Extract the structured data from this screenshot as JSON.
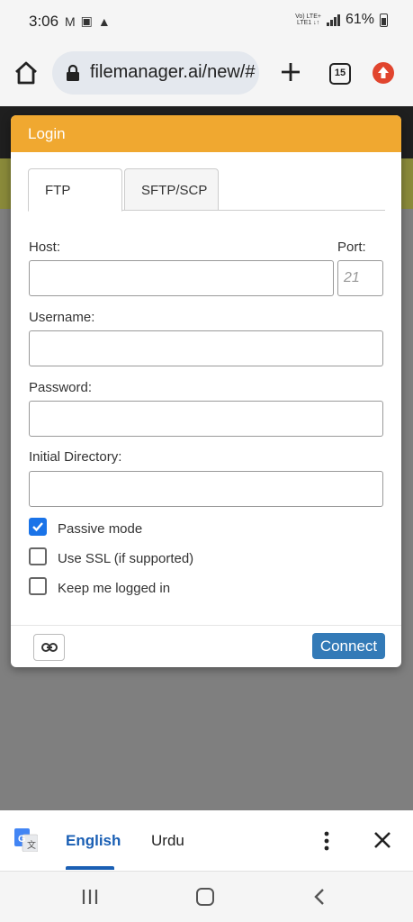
{
  "status_bar": {
    "time": "3:06",
    "network_top": "Vo) LTE+",
    "network_bottom": "LTE1 ↓↑",
    "battery": "61%"
  },
  "browser": {
    "url": "filemanager.ai/new/#",
    "tab_count": "15"
  },
  "dialog": {
    "title": "Login",
    "tabs": [
      {
        "label": "FTP",
        "active": true
      },
      {
        "label": "SFTP/SCP",
        "active": false
      }
    ],
    "host_label": "Host:",
    "host_value": "",
    "port_label": "Port:",
    "port_placeholder": "21",
    "username_label": "Username:",
    "username_value": "",
    "password_label": "Password:",
    "password_value": "",
    "initial_dir_label": "Initial Directory:",
    "initial_dir_value": "",
    "checkboxes": [
      {
        "label": "Passive mode",
        "checked": true
      },
      {
        "label": "Use SSL (if supported)",
        "checked": false
      },
      {
        "label": "Keep me logged in",
        "checked": false
      }
    ],
    "connect_label": "Connect"
  },
  "translate_bar": {
    "lang_from": "English",
    "lang_to": "Urdu"
  },
  "colors": {
    "header_orange": "#f0a830",
    "connect_blue": "#337ab7",
    "checkbox_blue": "#1a73e8"
  }
}
